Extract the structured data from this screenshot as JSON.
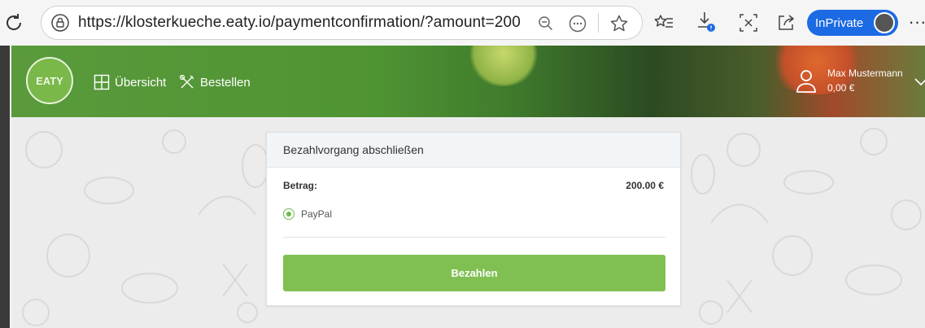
{
  "browser": {
    "url": "https://klosterkueche.eaty.io/paymentconfirmation/?amount=200",
    "profile_label": "InPrivate",
    "accent_color": "#1c6ae4",
    "icons": [
      "reload-icon",
      "lock-icon",
      "zoom-out-icon",
      "more-icon",
      "star-icon",
      "favorites-icon",
      "download-icon",
      "screenshot-icon",
      "share-icon",
      "menu-icon"
    ]
  },
  "header": {
    "logo_text": "EATY",
    "nav": [
      {
        "label": "Übersicht",
        "icon": "grid-icon"
      },
      {
        "label": "Bestellen",
        "icon": "utensils-icon"
      }
    ],
    "user": {
      "name": "Max Mustermann",
      "balance": "0,00 €"
    },
    "brand_color": "#4f9433"
  },
  "payment": {
    "title": "Bezahlvorgang abschließen",
    "amount_label": "Betrag:",
    "amount_value": "200.00 €",
    "method_label": "PayPal",
    "method_selected": true,
    "button_label": "Bezahlen",
    "button_color": "#80c052"
  }
}
